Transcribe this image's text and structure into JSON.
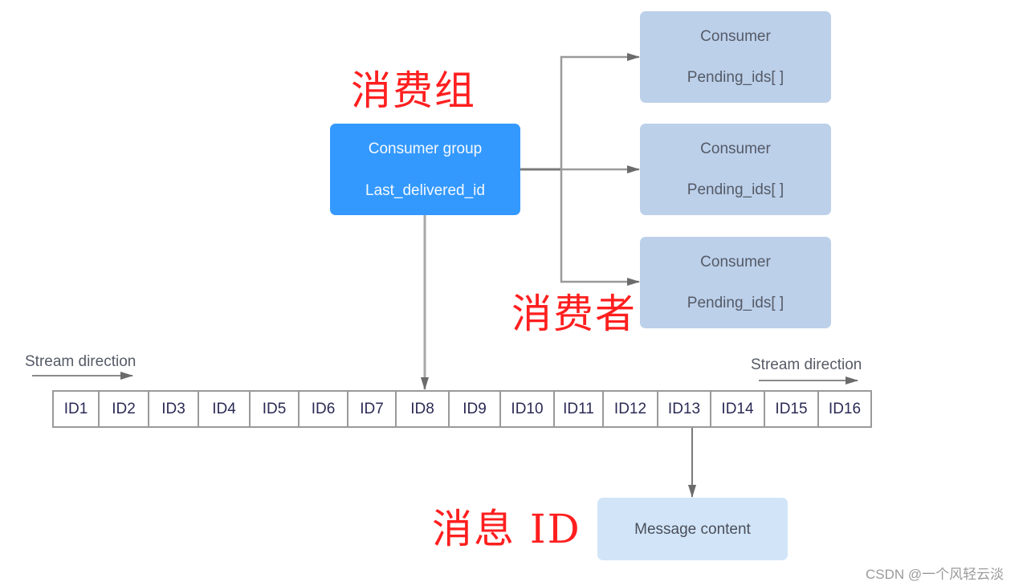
{
  "labels": {
    "consumer_group_cn": "消费组",
    "consumer_cn": "消费者",
    "message_id_cn": "消息 ID"
  },
  "consumer_group": {
    "title": "Consumer group",
    "field": "Last_delivered_id",
    "color": "#3399ff"
  },
  "consumers": [
    {
      "title": "Consumer",
      "field": "Pending_ids[ ]"
    },
    {
      "title": "Consumer",
      "field": "Pending_ids[ ]"
    },
    {
      "title": "Consumer",
      "field": "Pending_ids[ ]"
    }
  ],
  "consumer_color": "#bcd0ea",
  "stream": {
    "direction_label_left": "Stream direction",
    "direction_label_right": "Stream direction",
    "ids": [
      "ID1",
      "ID2",
      "ID3",
      "ID4",
      "ID5",
      "ID6",
      "ID7",
      "ID8",
      "ID9",
      "ID10",
      "ID11",
      "ID12",
      "ID13",
      "ID14",
      "ID15",
      "ID16"
    ],
    "last_delivered_points_to": "ID8",
    "message_points_from": "ID13"
  },
  "message": {
    "label": "Message content",
    "color": "#d2e5f8"
  },
  "annotation_color": "#ff1f1f",
  "watermark": "CSDN @一个风轻云淡"
}
